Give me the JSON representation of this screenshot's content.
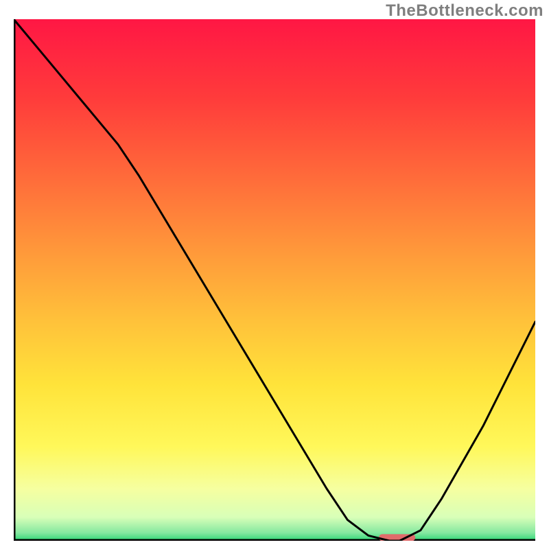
{
  "watermark": "TheBottleneck.com",
  "chart_data": {
    "type": "line",
    "title": "",
    "xlabel": "",
    "ylabel": "",
    "xlim": [
      0,
      100
    ],
    "ylim": [
      0,
      100
    ],
    "grid": false,
    "legend": false,
    "series": [
      {
        "name": "bottleneck-curve",
        "x": [
          0,
          5,
          10,
          15,
          20,
          24,
          30,
          36,
          42,
          48,
          54,
          60,
          64,
          68,
          72,
          74,
          78,
          82,
          86,
          90,
          94,
          100
        ],
        "y": [
          100,
          94,
          88,
          82,
          76,
          70,
          60,
          50,
          40,
          30,
          20,
          10,
          4,
          1,
          0,
          0,
          2,
          8,
          15,
          22,
          30,
          42
        ]
      }
    ],
    "marker": {
      "name": "optimal-range",
      "x_start": 70,
      "x_end": 77,
      "y": 0.6,
      "color": "#e06b6b"
    },
    "gradient_stops": [
      {
        "offset": 0.0,
        "color": "#ff1744"
      },
      {
        "offset": 0.15,
        "color": "#ff3b3b"
      },
      {
        "offset": 0.3,
        "color": "#ff6a3a"
      },
      {
        "offset": 0.45,
        "color": "#ff9a3a"
      },
      {
        "offset": 0.58,
        "color": "#ffc23a"
      },
      {
        "offset": 0.7,
        "color": "#ffe33a"
      },
      {
        "offset": 0.82,
        "color": "#fff85a"
      },
      {
        "offset": 0.9,
        "color": "#f6ffa0"
      },
      {
        "offset": 0.955,
        "color": "#d8ffb8"
      },
      {
        "offset": 0.985,
        "color": "#84e8a0"
      },
      {
        "offset": 1.0,
        "color": "#2bd574"
      }
    ],
    "axis_color": "#000000",
    "line_color": "#000000",
    "line_width": 3
  }
}
